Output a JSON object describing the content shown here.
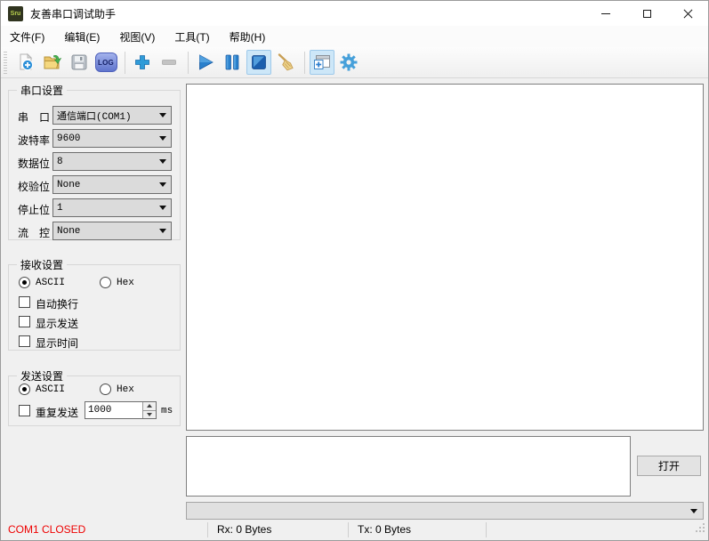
{
  "window": {
    "title": "友善串口调试助手",
    "app_icon_text": "Sru"
  },
  "menu_bar": {
    "items": [
      "文件(F)",
      "编辑(E)",
      "视图(V)",
      "工具(T)",
      "帮助(H)"
    ]
  },
  "toolbar": {
    "icons": [
      {
        "name": "new-file-icon"
      },
      {
        "name": "open-folder-icon"
      },
      {
        "name": "save-icon"
      },
      {
        "name": "log-icon",
        "label": "LOG"
      },
      {
        "name": "add-icon"
      },
      {
        "name": "remove-icon",
        "disabled": true
      },
      {
        "name": "start-icon"
      },
      {
        "name": "pause-icon"
      },
      {
        "name": "stop-icon",
        "active": true
      },
      {
        "name": "clear-icon"
      },
      {
        "name": "toggle-send-panel-icon",
        "active": true
      },
      {
        "name": "settings-icon"
      }
    ]
  },
  "serial_settings": {
    "title": "串口设置",
    "fields": [
      {
        "label": "串　口",
        "value": "通信端口(COM1)"
      },
      {
        "label": "波特率",
        "value": "9600"
      },
      {
        "label": "数据位",
        "value": "8"
      },
      {
        "label": "校验位",
        "value": "None"
      },
      {
        "label": "停止位",
        "value": "1"
      },
      {
        "label": "流　控",
        "value": "None"
      }
    ]
  },
  "receive_settings": {
    "title": "接收设置",
    "ascii_label": "ASCII",
    "hex_label": "Hex",
    "selected_mode": "ASCII",
    "options": [
      {
        "label": "自动换行",
        "checked": false
      },
      {
        "label": "显示发送",
        "checked": false
      },
      {
        "label": "显示时间",
        "checked": false
      }
    ]
  },
  "send_settings": {
    "title": "发送设置",
    "ascii_label": "ASCII",
    "hex_label": "Hex",
    "selected_mode": "ASCII",
    "repeat_label": "重复发送",
    "repeat_checked": false,
    "interval_value": "1000",
    "interval_unit": "ms"
  },
  "receive_area": {
    "content": ""
  },
  "send_area": {
    "content": "",
    "open_button": "打开"
  },
  "history_dropdown": {
    "value": ""
  },
  "status_bar": {
    "connection": "COM1 CLOSED",
    "connection_color": "#ee0000",
    "rx": "Rx: 0 Bytes",
    "tx": "Tx: 0 Bytes"
  }
}
